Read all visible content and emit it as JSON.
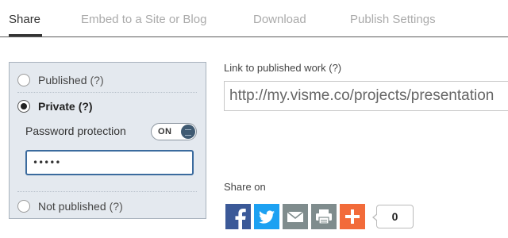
{
  "tabs": [
    {
      "label": "Share",
      "active": true
    },
    {
      "label": "Embed to a Site or Blog",
      "active": false
    },
    {
      "label": "Download",
      "active": false
    },
    {
      "label": "Publish Settings",
      "active": false
    }
  ],
  "publish_options": {
    "published": {
      "label": "Published",
      "help": "(?)",
      "selected": false
    },
    "private": {
      "label": "Private",
      "help": "(?)",
      "selected": true
    },
    "not_published": {
      "label": "Not published",
      "help": "(?)",
      "selected": false
    }
  },
  "password": {
    "label": "Password protection",
    "toggle_text": "ON",
    "toggle_on": true,
    "value": "•••••"
  },
  "link": {
    "label": "Link to published work (?)",
    "value": "http://my.visme.co/projects/presentation"
  },
  "share": {
    "label": "Share on",
    "count": "0",
    "buttons": [
      {
        "name": "facebook",
        "icon": "facebook-icon",
        "color": "#3b5998"
      },
      {
        "name": "twitter",
        "icon": "twitter-icon",
        "color": "#1da1f2"
      },
      {
        "name": "email",
        "icon": "mail-icon",
        "color": "#7f8c8d"
      },
      {
        "name": "print",
        "icon": "printer-icon",
        "color": "#7f8c8d"
      },
      {
        "name": "more",
        "icon": "plus-icon",
        "color": "#f26b3a"
      }
    ]
  }
}
